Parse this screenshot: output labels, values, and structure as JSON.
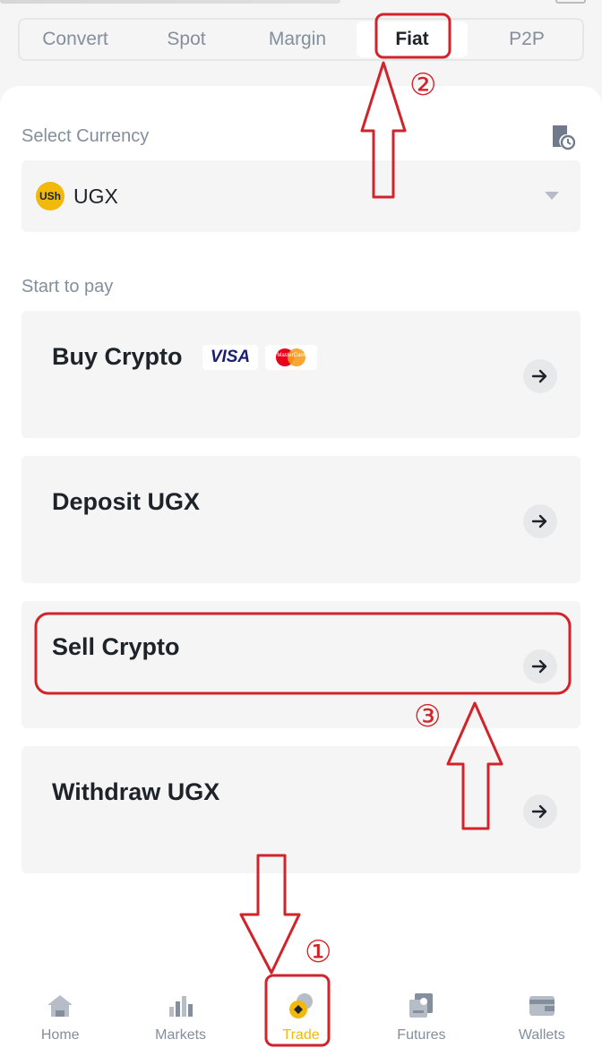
{
  "tabs": [
    {
      "label": "Convert",
      "active": false
    },
    {
      "label": "Spot",
      "active": false
    },
    {
      "label": "Margin",
      "active": false
    },
    {
      "label": "Fiat",
      "active": true
    },
    {
      "label": "P2P",
      "active": false
    }
  ],
  "select_currency": {
    "label": "Select Currency",
    "coin_symbol": "USh",
    "value": "UGX"
  },
  "start_to_pay": {
    "label": "Start to pay",
    "cards": [
      {
        "title": "Buy Crypto",
        "badges": [
          "VISA",
          "MasterCard"
        ]
      },
      {
        "title": "Deposit UGX"
      },
      {
        "title": "Sell Crypto"
      },
      {
        "title": "Withdraw UGX"
      }
    ]
  },
  "bottom_nav": [
    {
      "label": "Home",
      "icon": "home-icon"
    },
    {
      "label": "Markets",
      "icon": "markets-icon"
    },
    {
      "label": "Trade",
      "icon": "trade-icon",
      "active": true
    },
    {
      "label": "Futures",
      "icon": "futures-icon"
    },
    {
      "label": "Wallets",
      "icon": "wallets-icon"
    }
  ],
  "annotations": {
    "step1": "①",
    "step2": "②",
    "step3": "③",
    "color": "#d2232a"
  },
  "colors": {
    "accent": "#f0b90b",
    "text_primary": "#1e2329",
    "text_secondary": "#848e9c",
    "card_bg": "#f5f5f5"
  }
}
